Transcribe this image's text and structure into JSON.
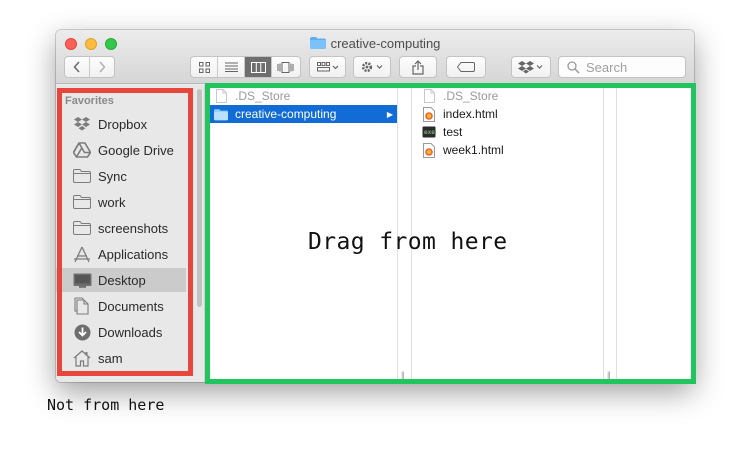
{
  "window": {
    "title": "creative-computing"
  },
  "toolbar": {
    "search_placeholder": "Search"
  },
  "sidebar": {
    "header": "Favorites",
    "items": [
      {
        "label": "Dropbox",
        "icon": "dropbox-icon"
      },
      {
        "label": "Google Drive",
        "icon": "google-drive-icon"
      },
      {
        "label": "Sync",
        "icon": "folder-icon"
      },
      {
        "label": "work",
        "icon": "folder-icon"
      },
      {
        "label": "screenshots",
        "icon": "folder-icon"
      },
      {
        "label": "Applications",
        "icon": "applications-icon"
      },
      {
        "label": "Desktop",
        "icon": "desktop-icon",
        "selected": true
      },
      {
        "label": "Documents",
        "icon": "documents-icon"
      },
      {
        "label": "Downloads",
        "icon": "downloads-icon"
      },
      {
        "label": "sam",
        "icon": "home-icon"
      }
    ]
  },
  "columns": {
    "col1": [
      {
        "label": ".DS_Store",
        "dim": true
      },
      {
        "label": "creative-computing",
        "selected": true
      }
    ],
    "col2": [
      {
        "label": ".DS_Store",
        "dim": true
      },
      {
        "label": "index.html"
      },
      {
        "label": "test"
      },
      {
        "label": "week1.html"
      }
    ]
  },
  "annotations": {
    "drag_label": "Drag from here",
    "not_label": "Not from here"
  },
  "colors": {
    "red_box": "#e6463c",
    "green_box": "#21c45d",
    "selection": "#116cd6"
  }
}
